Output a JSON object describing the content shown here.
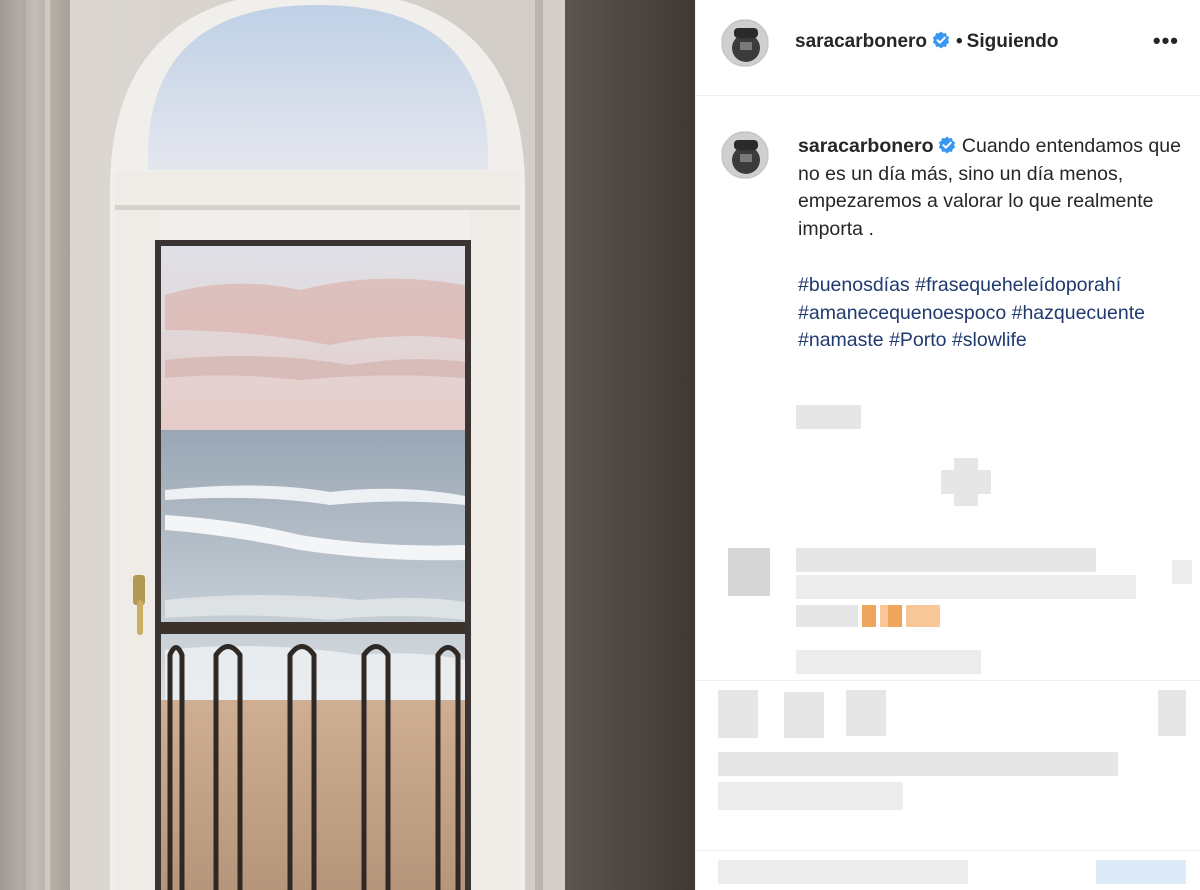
{
  "post": {
    "username": "saracarbonero",
    "follow_status": "Siguiendo",
    "separator": "•",
    "more_label": "•••",
    "verified_color": "#3897f0",
    "caption": "Cuando entendamos que no es un día más, sino un día menos, empezaremos a valorar lo que realmente importa .",
    "hashtags": [
      "#buenosdías",
      "#frasequeheleídoporahí",
      "#amanecequenoespoco",
      "#hazquecuente",
      "#namaste",
      "#Porto",
      "#slowlife"
    ]
  },
  "icons": {
    "verified": "verified-badge-icon",
    "more": "more-options-icon"
  },
  "colors": {
    "hashtag": "#1f3a6e",
    "text": "#262626"
  }
}
